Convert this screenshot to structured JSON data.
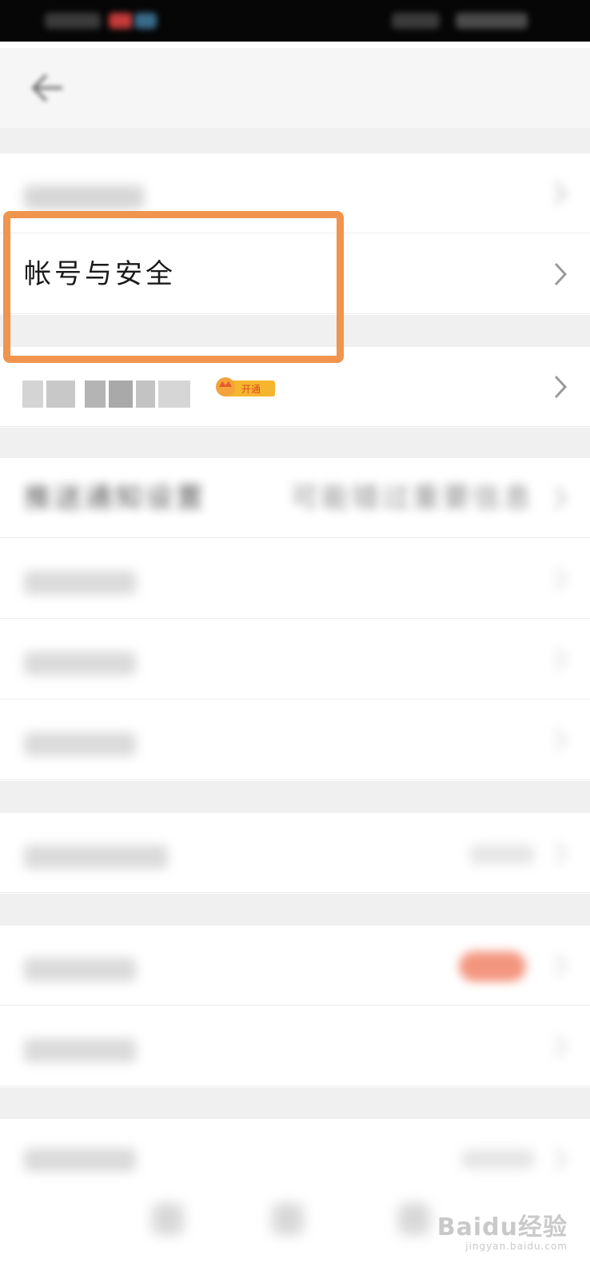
{
  "nav": {
    "title": ""
  },
  "rows": {
    "account_security": "帐号与安全",
    "push_notification": "推送通知设置",
    "push_notification_value": "可能错过重要信息"
  },
  "vip_badge": {
    "label": "开通"
  },
  "watermark": {
    "brand": "Baidu经验",
    "url": "jingyan.baidu.com"
  },
  "colors": {
    "highlight": "#f0944e",
    "badge_bg": "#f5b52e",
    "badge_text": "#d94a1e",
    "pill": "#f07355"
  },
  "icons": [
    "back-arrow-icon",
    "chevron-right-icon",
    "crown-icon"
  ]
}
